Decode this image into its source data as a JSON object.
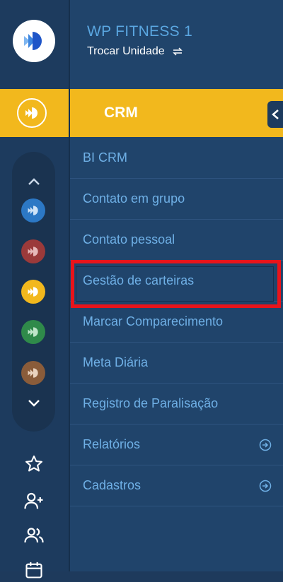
{
  "header": {
    "unit_name": "WP FITNESS 1",
    "switch_unit_label": "Trocar Unidade"
  },
  "module": {
    "title": "CRM"
  },
  "menu": {
    "items": [
      {
        "label": "BI CRM"
      },
      {
        "label": "Contato em grupo"
      },
      {
        "label": "Contato pessoal"
      },
      {
        "label": "Gestão de carteiras"
      },
      {
        "label": "Marcar Comparecimento"
      },
      {
        "label": "Meta Diária"
      },
      {
        "label": "Registro de Paralisação"
      },
      {
        "label": "Relatórios"
      },
      {
        "label": "Cadastros"
      }
    ]
  },
  "rail": {
    "module_icons": [
      {
        "name": "module-blue-icon",
        "color": "#2c78c5"
      },
      {
        "name": "module-red-icon",
        "color": "#9b3a3a"
      },
      {
        "name": "module-yellow-icon",
        "color": "#f2b81d"
      },
      {
        "name": "module-green-icon",
        "color": "#2f8a4a"
      },
      {
        "name": "module-brown-icon",
        "color": "#8a5c3a"
      }
    ],
    "bottom_icons": [
      "star-icon",
      "add-user-icon",
      "users-icon",
      "calendar-icon"
    ]
  },
  "colors": {
    "accent": "#f2b81d",
    "highlight": "#e8141b",
    "menu_text": "#6fb0e6"
  }
}
